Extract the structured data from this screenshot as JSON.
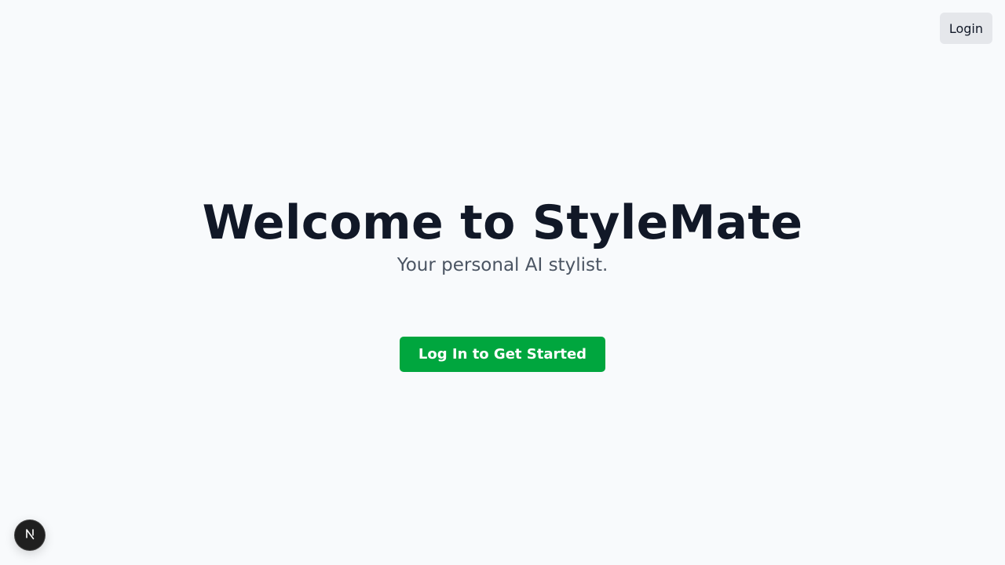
{
  "header": {
    "login_label": "Login"
  },
  "hero": {
    "title": "Welcome to StyleMate",
    "subtitle": "Your personal AI stylist."
  },
  "cta": {
    "label": "Log In to Get Started"
  },
  "dev_badge": {
    "icon": "nextjs-logo-icon",
    "letter": "N"
  },
  "colors": {
    "background": "#f8fafc",
    "primary_button": "#00a63e",
    "title_text": "#111827",
    "subtitle_text": "#4b5563",
    "secondary_button": "#e5e7eb"
  }
}
